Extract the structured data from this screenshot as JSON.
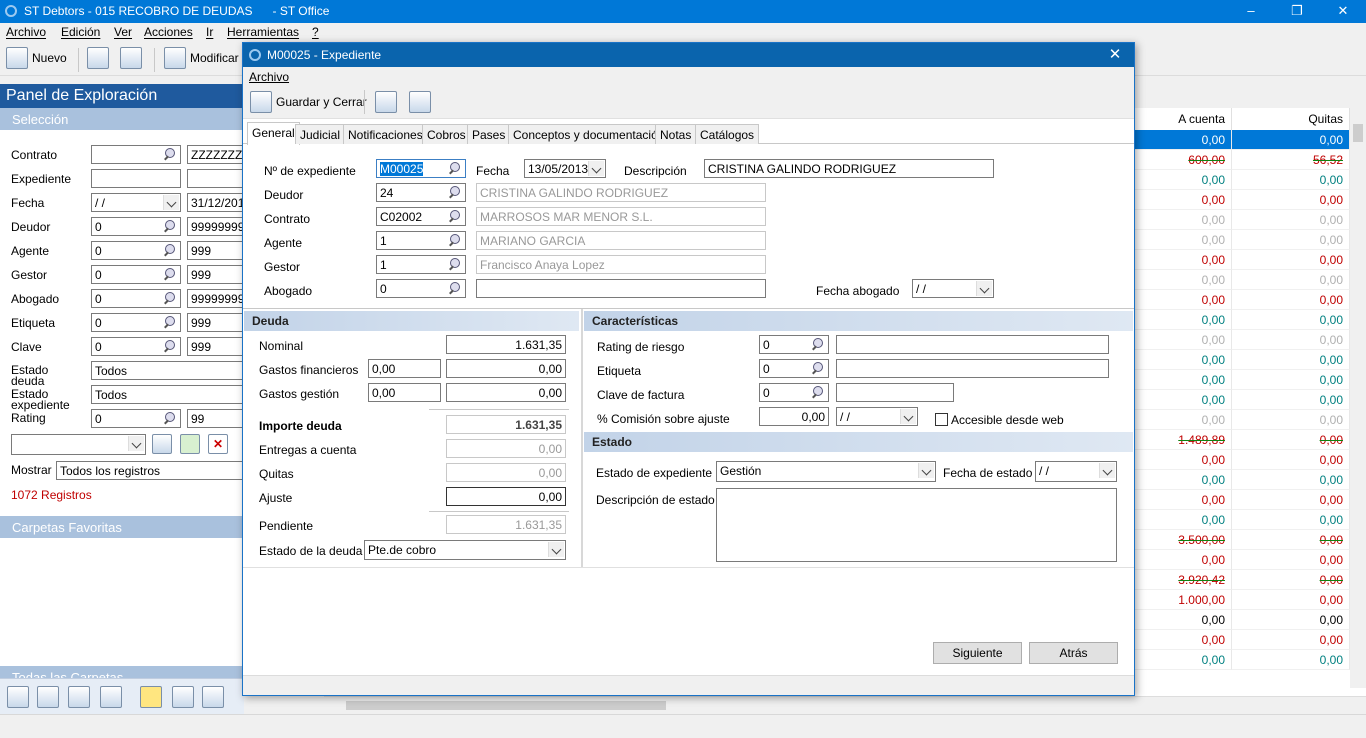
{
  "app": {
    "title": "ST Debtors - 015 RECOBRO DE DEUDAS      - ST Office",
    "minimize": "–",
    "maximize": "❐",
    "close": "✕"
  },
  "menu": [
    "Archivo",
    "Edición",
    "Ver",
    "Acciones",
    "Ir",
    "Herramientas",
    "?"
  ],
  "toolbar": {
    "nuevo": "Nuevo",
    "modificar": "Modificar"
  },
  "panel": {
    "title": "Panel de Exploración",
    "seleccion": "Selección",
    "fields": [
      {
        "label": "Contrato",
        "a": "",
        "b": "ZZZZZZZ"
      },
      {
        "label": "Expediente",
        "a": "",
        "b": ""
      },
      {
        "label": "Fecha",
        "a": " /  /",
        "b": "31/12/2017"
      },
      {
        "label": "Deudor",
        "a": "0",
        "b": "9999999999"
      },
      {
        "label": "Agente",
        "a": "0",
        "b": "999"
      },
      {
        "label": "Gestor",
        "a": "0",
        "b": "999"
      },
      {
        "label": "Abogado",
        "a": "0",
        "b": "9999999999"
      },
      {
        "label": "Etiqueta",
        "a": "0",
        "b": "999"
      },
      {
        "label": "Clave",
        "a": "0",
        "b": "999"
      }
    ],
    "estado_deuda_label": "Estado deuda",
    "estado_deuda": "Todos",
    "estado_exp_label": "Estado expediente",
    "estado_exp": "Todos",
    "rating_label": "Rating",
    "rating_a": "0",
    "rating_b": "99",
    "mostrar_label": "Mostrar",
    "mostrar": "Todos los registros",
    "registros": "1072 Registros",
    "favoritas": "Carpetas Favoritas",
    "todas": "Todas las Carpetas"
  },
  "grid": {
    "col_acuenta": "A cuenta",
    "col_quitas": "Quitas",
    "rows": [
      {
        "a": "0,00",
        "q": "0,00",
        "c": "#0070c0",
        "sel": true
      },
      {
        "a": "600,00",
        "q": "56,52",
        "c": "#c00000",
        "s": true
      },
      {
        "a": "0,00",
        "q": "0,00",
        "c": "#008080"
      },
      {
        "a": "0,00",
        "q": "0,00",
        "c": "#c00000"
      },
      {
        "a": "0,00",
        "q": "0,00",
        "c": "#b0b0b0"
      },
      {
        "a": "0,00",
        "q": "0,00",
        "c": "#b0b0b0"
      },
      {
        "a": "0,00",
        "q": "0,00",
        "c": "#c00000"
      },
      {
        "a": "0,00",
        "q": "0,00",
        "c": "#b0b0b0"
      },
      {
        "a": "0,00",
        "q": "0,00",
        "c": "#c00000"
      },
      {
        "a": "0,00",
        "q": "0,00",
        "c": "#008080"
      },
      {
        "a": "0,00",
        "q": "0,00",
        "c": "#b0b0b0"
      },
      {
        "a": "0,00",
        "q": "0,00",
        "c": "#008080"
      },
      {
        "a": "0,00",
        "q": "0,00",
        "c": "#008080"
      },
      {
        "a": "0,00",
        "q": "0,00",
        "c": "#008080"
      },
      {
        "a": "0,00",
        "q": "0,00",
        "c": "#b0b0b0"
      },
      {
        "a": "1.489,89",
        "q": "0,00",
        "c": "#c00000",
        "s": true
      },
      {
        "a": "0,00",
        "q": "0,00",
        "c": "#c00000"
      },
      {
        "a": "0,00",
        "q": "0,00",
        "c": "#008080"
      },
      {
        "a": "0,00",
        "q": "0,00",
        "c": "#c00000"
      },
      {
        "a": "0,00",
        "q": "0,00",
        "c": "#008080"
      },
      {
        "a": "3.500,00",
        "q": "0,00",
        "c": "#c00000",
        "s": true
      },
      {
        "a": "0,00",
        "q": "0,00",
        "c": "#c00000"
      },
      {
        "a": "3.920,42",
        "q": "0,00",
        "c": "#c00000",
        "s": true
      },
      {
        "a": "1.000,00",
        "q": "0,00",
        "c": "#c00000"
      },
      {
        "a": "0,00",
        "q": "0,00",
        "c": "#000000"
      },
      {
        "a": "0,00",
        "q": "0,00",
        "c": "#c00000"
      },
      {
        "a": "0,00",
        "q": "0,00",
        "c": "#008080"
      }
    ]
  },
  "dialog": {
    "title": "M00025 - Expediente",
    "menu": "Archivo",
    "guardar": "Guardar y Cerrar",
    "tabs": [
      "General",
      "Judicial",
      "Notificaciones",
      "Cobros",
      "Pases",
      "Conceptos y documentación",
      "Notas",
      "Catálogos"
    ],
    "exp_label": "Nº de expediente",
    "exp": "M00025",
    "fecha_label": "Fecha",
    "fecha": "13/05/2013",
    "desc_label": "Descripción",
    "desc": "CRISTINA GALINDO RODRIGUEZ",
    "deudor_label": "Deudor",
    "deudor": "24",
    "deudor_n": "CRISTINA GALINDO RODRIGUEZ",
    "contrato_label": "Contrato",
    "contrato": "C02002",
    "contrato_n": "MARROSOS MAR MENOR S.L.",
    "agente_label": "Agente",
    "agente": "1",
    "agente_n": "MARIANO GARCIA",
    "gestor_label": "Gestor",
    "gestor": "1",
    "gestor_n": "Francisco Anaya Lopez",
    "abogado_label": "Abogado",
    "abogado": "0",
    "fabogado_label": "Fecha abogado",
    "fabogado": " /  /",
    "deuda": {
      "title": "Deuda",
      "nominal_l": "Nominal",
      "nominal": "1.631,35",
      "gfin_l": "Gastos financieros",
      "gfin_a": "0,00",
      "gfin_b": "0,00",
      "gges_l": "Gastos gestión",
      "gges_a": "0,00",
      "gges_b": "0,00",
      "importe_l": "Importe deuda",
      "importe": "1.631,35",
      "entregas_l": "Entregas a cuenta",
      "entregas": "0,00",
      "quitas_l": "Quitas",
      "quitas": "0,00",
      "ajuste_l": "Ajuste",
      "ajuste": "0,00",
      "pend_l": "Pendiente",
      "pend": "1.631,35",
      "estado_l": "Estado de la deuda",
      "estado": "Pte.de cobro"
    },
    "car": {
      "title": "Características",
      "rating_l": "Rating de riesgo",
      "rating": "0",
      "etiq_l": "Etiqueta",
      "etiq": "0",
      "clave_l": "Clave de factura",
      "clave": "0",
      "com_l": "% Comisión sobre ajuste",
      "com": "0,00",
      "comf": " /  /",
      "web": "Accesible desde web"
    },
    "estado": {
      "title": "Estado",
      "exp_l": "Estado de expediente",
      "exp": "Gestión",
      "fecha_l": "Fecha de estado",
      "fecha": " /  /",
      "desc_l": "Descripción de estado"
    },
    "siguiente": "Siguiente",
    "atras": "Atrás"
  }
}
